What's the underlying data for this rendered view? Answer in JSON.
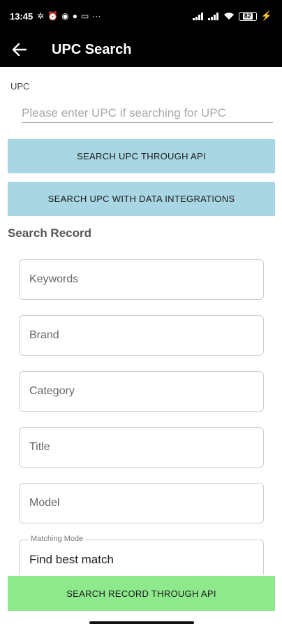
{
  "status_bar": {
    "time": "13:45",
    "battery": "82",
    "left_icons": [
      "settings-icon",
      "alarm-icon",
      "messenger-icon",
      "facebook-icon",
      "screen-icon",
      "more-icon"
    ],
    "right_icons": [
      "signal-icon",
      "signal-icon",
      "wifi-icon",
      "battery-icon",
      "charging-icon"
    ]
  },
  "app_bar": {
    "title": "UPC Search",
    "back_icon": "arrow-left-icon"
  },
  "upc": {
    "label": "UPC",
    "placeholder": "Please enter UPC if searching for UPC"
  },
  "buttons": {
    "search_api": "SEARCH UPC THROUGH API",
    "search_integrations": "SEARCH UPC WITH DATA INTEGRATIONS",
    "search_record_api": "SEARCH RECORD THROUGH API"
  },
  "search_record": {
    "title": "Search Record",
    "fields": {
      "keywords": "Keywords",
      "brand": "Brand",
      "category": "Category",
      "title": "Title",
      "model": "Model"
    },
    "matching_mode": {
      "label": "Matching Mode",
      "value": "Find best match"
    }
  },
  "colors": {
    "blue_button": "#a8d6e3",
    "green_button": "#8ee88c",
    "header": "#000000"
  }
}
